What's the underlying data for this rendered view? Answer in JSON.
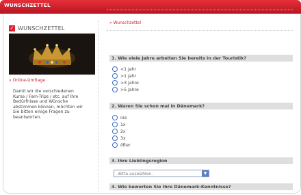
{
  "window": {
    "title": "WUNSCHZETTEL"
  },
  "sidebar": {
    "heading": "WUNSCHZETTEL",
    "link": "» Online-Umfrage",
    "body": "Damit wir die verschiedenen Kurse / Fam-Trips / etc. auf Ihre Bedürfnisse und Wünsche abstimmen können, möchten wir Sie bitten einige Fragen zu beantworten."
  },
  "main": {
    "breadcrumb": "» Wunschzettel",
    "questions": [
      {
        "title": "1. Wie viele Jahre arbeiten Sie bereits in der Touristik?",
        "options": [
          "<1 Jahr",
          ">1 Jahr",
          ">3 Jahre",
          ">5 Jahre"
        ]
      },
      {
        "title": "2. Waren Sie schon mal in Dänemark?",
        "options": [
          "nie",
          "1x",
          "2x",
          "3x",
          "öfter"
        ]
      },
      {
        "title": "3. Ihre Lieblingsregion",
        "select_value": "-Bitte auswählen-"
      },
      {
        "title": "4. Wie bewerten Sie Ihre Dänemark-Kenntnisse?"
      }
    ]
  }
}
